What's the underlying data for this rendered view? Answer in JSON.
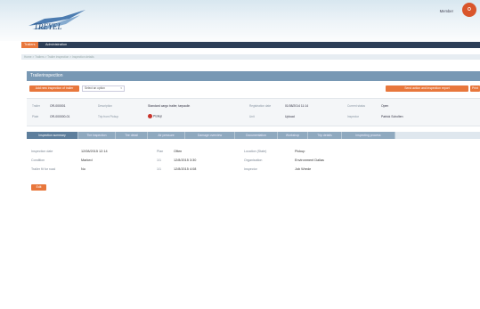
{
  "header": {
    "logo_text": "TREYEL",
    "user_name": "Member",
    "user_badge": "O"
  },
  "main_tabs": [
    "Trailers",
    "Administration"
  ],
  "breadcrumb": "Home > Trailers > Trailer inspection > Inspection details",
  "panel_title": "Trailerinspection",
  "toolbar": {
    "action_button": "Add new inspection of trailer",
    "select_value": "Select an option",
    "right_button": "Send action and inspection report",
    "right_button_small": "Print"
  },
  "summary": {
    "row1": [
      {
        "label": "Trailer",
        "value": "OR-000001"
      },
      {
        "label": "Description",
        "value": "Standard cargo trailer, tarpaulin"
      },
      {
        "label": "Registration date",
        "value": "01/08/2014 11:14"
      },
      {
        "label": "Current status",
        "value": "Open"
      }
    ],
    "row2": [
      {
        "label": "Plate",
        "value": "OR-000000-01"
      },
      {
        "label": "Trip from Pickup",
        "value": "Pickup",
        "flag": true
      },
      {
        "label": "Unit",
        "value": "Upload"
      },
      {
        "label": "Inspector",
        "value": "Patrick Scholten"
      }
    ]
  },
  "sub_tabs": [
    {
      "label": "Inspection summary",
      "active": true
    },
    {
      "label": "Tire inspection",
      "active": false
    },
    {
      "label": "Tire detail",
      "active": false
    },
    {
      "label": "Air pressure",
      "active": false
    },
    {
      "label": "Damage overview",
      "active": false
    },
    {
      "label": "Documentation",
      "active": false
    },
    {
      "label": "Workshop",
      "active": false
    },
    {
      "label": "Trip details",
      "active": false
    },
    {
      "label": "Inspecting process",
      "active": false
    }
  ],
  "details": {
    "col1": [
      {
        "label": "Inspection date",
        "value": "12/08/2015 12:14"
      },
      {
        "label": "Condition",
        "value": "Marked"
      },
      {
        "label": "Trailer fit for road",
        "value": "No"
      }
    ],
    "col2": [
      {
        "label": "Plan",
        "value": "Often"
      },
      {
        "label": "1/1",
        "value": "12/8/2015 3:30"
      },
      {
        "label": "1/1",
        "value": "12/8/2015 4:08"
      }
    ],
    "col3": [
      {
        "label": "Location (State)",
        "value": "Pickup"
      },
      {
        "label": "Organisation",
        "value": "Environment Dallas"
      },
      {
        "label": "Inspector",
        "value": "Job Wrede"
      }
    ]
  },
  "edit_button": "Edit",
  "colors": {
    "accent": "#e8773c",
    "nav_dark": "#2c3e57",
    "panel_blue": "#7898b4",
    "tab_active": "#5d7e9c",
    "flag_red": "#c8322a"
  }
}
